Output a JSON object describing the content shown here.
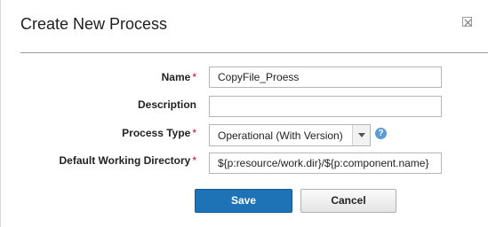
{
  "dialog": {
    "title": "Create New Process",
    "close_icon": "close-icon"
  },
  "form": {
    "name": {
      "label": "Name",
      "required": "*",
      "value": "CopyFile_Proess"
    },
    "description": {
      "label": "Description",
      "value": ""
    },
    "process_type": {
      "label": "Process Type",
      "required": "*",
      "value": "Operational (With Version)",
      "help": "?"
    },
    "working_dir": {
      "label": "Default Working Directory",
      "required": "*",
      "value": "${p:resource/work.dir}/${p:component.name}"
    }
  },
  "buttons": {
    "save": "Save",
    "cancel": "Cancel"
  },
  "colors": {
    "primary_button": "#1e73b6",
    "required": "#d0021b",
    "help_icon": "#5b9bd5"
  }
}
